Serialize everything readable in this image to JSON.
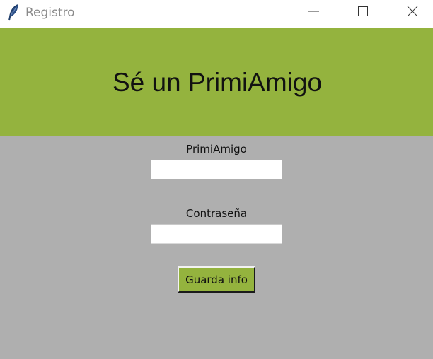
{
  "window": {
    "title": "Registro",
    "app_icon": "feather-icon",
    "controls": {
      "minimize": "minimize-icon",
      "maximize": "maximize-icon",
      "close": "close-icon"
    }
  },
  "banner": {
    "heading": "Sé un PrimiAmigo",
    "background": "#94b33e"
  },
  "form": {
    "username_label": "PrimiAmigo",
    "username_value": "",
    "password_label": "Contraseña",
    "password_value": "",
    "submit_label": "Guarda info"
  },
  "colors": {
    "content_background": "#afafaf",
    "accent": "#94b33e"
  }
}
